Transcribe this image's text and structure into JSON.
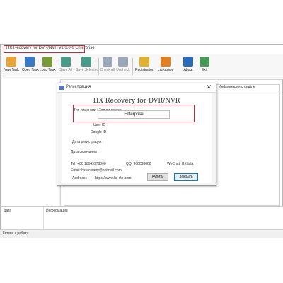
{
  "window": {
    "title": "HX Recovery for DVR/NVR  v1.0.0.0 Enterprise",
    "toolbar": [
      {
        "label": "New Task",
        "icon": "new-task-icon",
        "color": "#e8a23a",
        "enabled": true
      },
      {
        "label": "Open Task",
        "icon": "open-task-icon",
        "color": "#3a78c8",
        "enabled": true
      },
      {
        "label": "Load Task",
        "icon": "load-task-icon",
        "color": "#7a9a3a",
        "enabled": true
      },
      {
        "label": "Save All",
        "icon": "save-all-icon",
        "color": "#4a9a8a",
        "enabled": false
      },
      {
        "label": "Save Selected",
        "icon": "save-selected-icon",
        "color": "#4a9a8a",
        "enabled": false
      },
      {
        "label": "Check All",
        "icon": "check-all-icon",
        "color": "#9aa8b8",
        "enabled": false
      },
      {
        "label": "Uncheck",
        "icon": "uncheck-icon",
        "color": "#9aa8b8",
        "enabled": false
      },
      {
        "label": "Registration",
        "icon": "key-icon",
        "color": "#e0b030",
        "enabled": true
      },
      {
        "label": "Language",
        "icon": "language-icon",
        "color": "#e08020",
        "enabled": true
      },
      {
        "label": "About",
        "icon": "about-icon",
        "color": "#2a6ab8",
        "enabled": true
      },
      {
        "label": "Exit",
        "icon": "exit-icon",
        "color": "#4a9a5a",
        "enabled": true
      }
    ],
    "right_header": "Информация о файле",
    "log_headers": [
      "Дата",
      "Информация"
    ],
    "status": "Готово к работе"
  },
  "dialog": {
    "title": "Регистрация",
    "app_name": "HX Recovery for DVR/NVR",
    "license_type_label": "Тип лицензии : Тип лицензии",
    "license_value": "Enterprise",
    "user_id_label": "User ID",
    "dongle_id_label": "Dongle ID",
    "reg_date_label": "Дата регистрации :",
    "expire_label": "Дата окончания :",
    "phone": "Tel: +86 18049978000",
    "qq": "QQ: 908838668",
    "wechat": "WeChat: HXdata",
    "email": "Email: hxrecovery@hotmail.com",
    "address_label": "Address :",
    "website": "https://www.hx-dvr.com",
    "purchase_button": "Купить",
    "close_button": "Закрыть",
    "close_x": "✕",
    "accent_color": "#e0202a"
  }
}
